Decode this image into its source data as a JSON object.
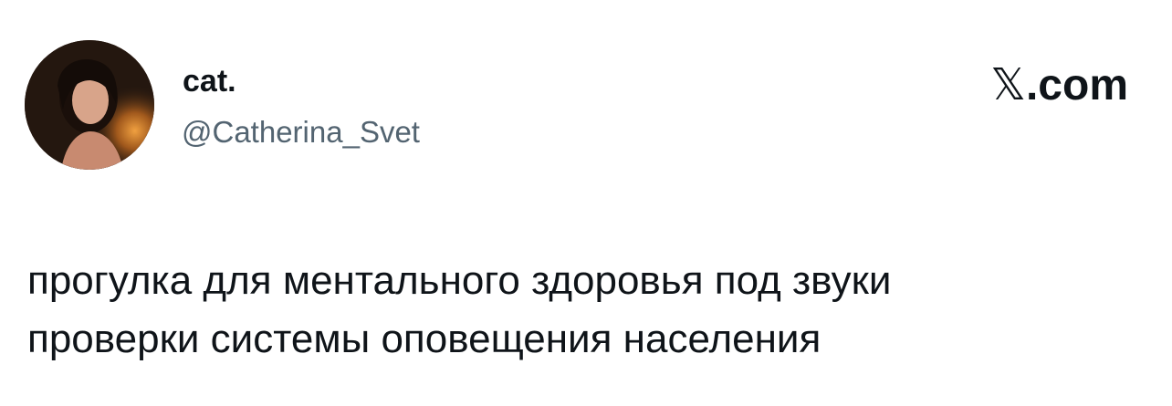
{
  "author": {
    "display_name": "cat.",
    "handle": "@Catherina_Svet",
    "avatar_icon": "profile-photo"
  },
  "brand": {
    "x_glyph": "𝕏",
    "suffix": ".com"
  },
  "tweet": {
    "lines": [
      "прогулка для ментального здоровья под звуки",
      "проверки системы оповещения населения"
    ]
  },
  "colors": {
    "text_primary": "#0f1419",
    "text_secondary": "#536471",
    "background": "#ffffff"
  }
}
